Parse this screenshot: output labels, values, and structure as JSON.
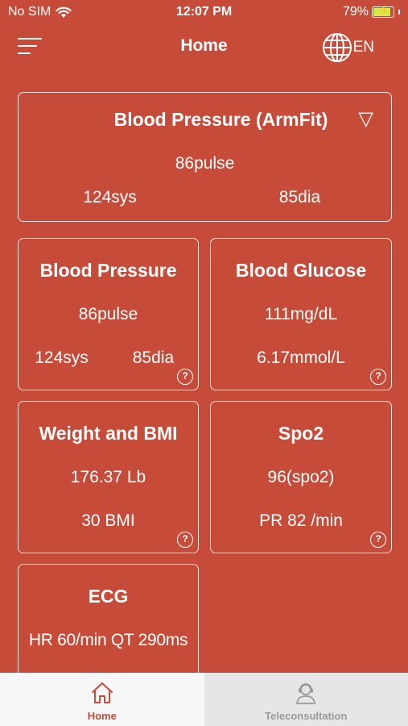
{
  "status_bar": {
    "carrier": "No SIM",
    "time": "12:07 PM",
    "battery": "79%"
  },
  "nav": {
    "title": "Home",
    "language": "EN"
  },
  "top_card": {
    "title": "Blood Pressure (ArmFit)",
    "dropdown_glyph": "▽",
    "pulse": "86pulse",
    "sys": "124sys",
    "dia": "85dia"
  },
  "cards": {
    "blood_pressure": {
      "title": "Blood Pressure",
      "pulse": "86pulse",
      "sys": "124sys",
      "dia": "85dia"
    },
    "blood_glucose": {
      "title": "Blood Glucose",
      "mgdl": "111mg/dL",
      "mmol": "6.17mmol/L"
    },
    "weight_bmi": {
      "title": "Weight and BMI",
      "weight": "176.37 Lb",
      "bmi": "30 BMI"
    },
    "spo2": {
      "title": "Spo2",
      "value": "96(spo2)",
      "pr": "PR 82 /min"
    },
    "ecg": {
      "title": "ECG",
      "hr": "HR 60/min",
      "qt": "QT 290ms"
    }
  },
  "help_glyph": "?",
  "tabs": [
    {
      "label": "Home",
      "icon": "home-icon",
      "active": true
    },
    {
      "label": "Teleconsultation",
      "icon": "doctor-headset-icon",
      "active": false
    }
  ],
  "colors": {
    "background": "#c64b38",
    "tab_active": "#c64b38",
    "tab_inactive": "#9a9a9a"
  }
}
